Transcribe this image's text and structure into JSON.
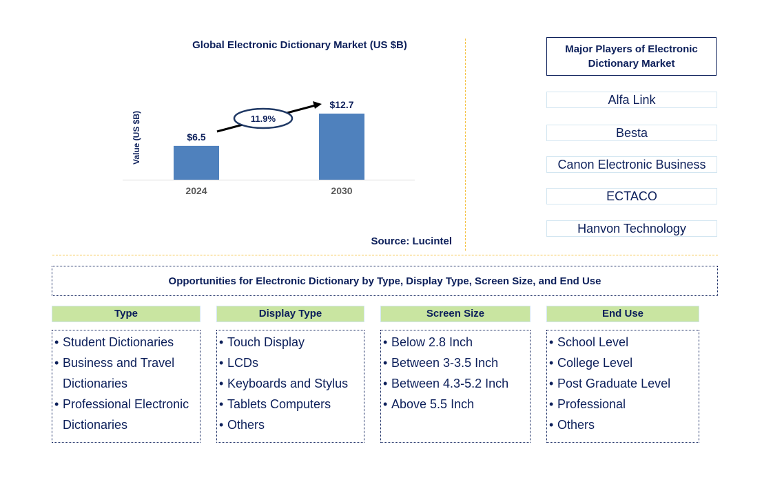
{
  "chart_data": {
    "type": "bar",
    "title": "Global Electronic Dictionary Market (US $B)",
    "xlabel": "",
    "ylabel": "Value (US $B)",
    "categories": [
      "2024",
      "2030"
    ],
    "values": [
      6.5,
      12.7
    ],
    "data_labels": [
      "$6.5",
      "$12.7"
    ],
    "ylim": [
      0,
      14
    ],
    "grid": false,
    "bar_color": "#4f81bd",
    "annotation": {
      "type": "cagr-arrow",
      "label": "11.9%"
    }
  },
  "source": "Source: Lucintel",
  "players": {
    "title": "Major Players of Electronic Dictionary Market",
    "items": [
      "Alfa Link",
      "Besta",
      "Canon Electronic Business",
      "ECTACO",
      "Hanvon Technology"
    ]
  },
  "opportunities": {
    "title": "Opportunities for Electronic Dictionary by Type, Display Type, Screen Size, and End Use",
    "categories": [
      {
        "header": "Type",
        "items": [
          [
            "Student Dictionaries"
          ],
          [
            "Business and Travel",
            "Dictionaries"
          ],
          [
            "Professional Electronic",
            "Dictionaries"
          ]
        ]
      },
      {
        "header": "Display Type",
        "items": [
          [
            "Touch Display"
          ],
          [
            "LCDs"
          ],
          [
            "Keyboards and Stylus"
          ],
          [
            "Tablets Computers"
          ],
          [
            "Others"
          ]
        ]
      },
      {
        "header": "Screen Size",
        "items": [
          [
            "Below 2.8 Inch"
          ],
          [
            "Between 3-3.5 Inch"
          ],
          [
            "Between 4.3-5.2 Inch"
          ],
          [
            "Above 5.5 Inch"
          ]
        ]
      },
      {
        "header": "End Use",
        "items": [
          [
            "School Level"
          ],
          [
            "College Level"
          ],
          [
            "Post Graduate Level"
          ],
          [
            "Professional"
          ],
          [
            "Others"
          ]
        ]
      }
    ]
  },
  "colors": {
    "text": "#0c1f5a",
    "bar": "#4f81bd",
    "divider": "#f5c242",
    "header_bg": "#c9e5a1"
  }
}
